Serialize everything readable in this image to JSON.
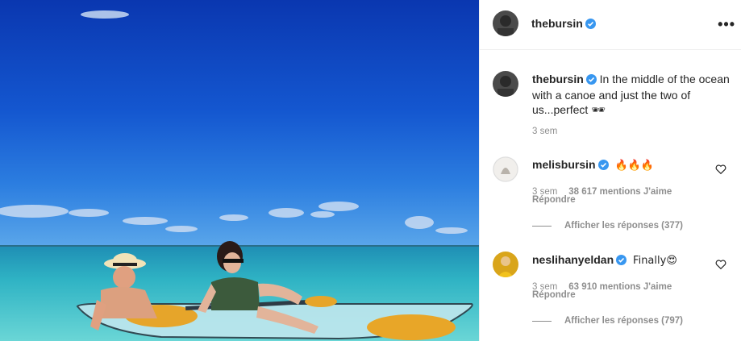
{
  "post": {
    "author": "thebursin",
    "caption": "In the middle of the ocean with a canoe and just the two of us...perfect 🕶",
    "time": "3 sem"
  },
  "comments": [
    {
      "username": "melisbursin",
      "text": "🔥🔥🔥",
      "time": "3 sem",
      "likes": "38 617 mentions J'aime",
      "reply_label": "Répondre",
      "view_replies": "Afficher les réponses (377)"
    },
    {
      "username": "neslihanyeldan",
      "text": "Finally😍",
      "time": "3 sem",
      "likes": "63 910 mentions J'aime",
      "reply_label": "Répondre",
      "view_replies": "Afficher les réponses (797)"
    }
  ],
  "icons": {
    "verified": "verified-badge-icon",
    "more": "more-options-icon",
    "like": "heart-icon"
  },
  "colors": {
    "verified": "#3897f0",
    "muted": "#8e8e8e",
    "text": "#262626",
    "divider": "#efefef"
  }
}
